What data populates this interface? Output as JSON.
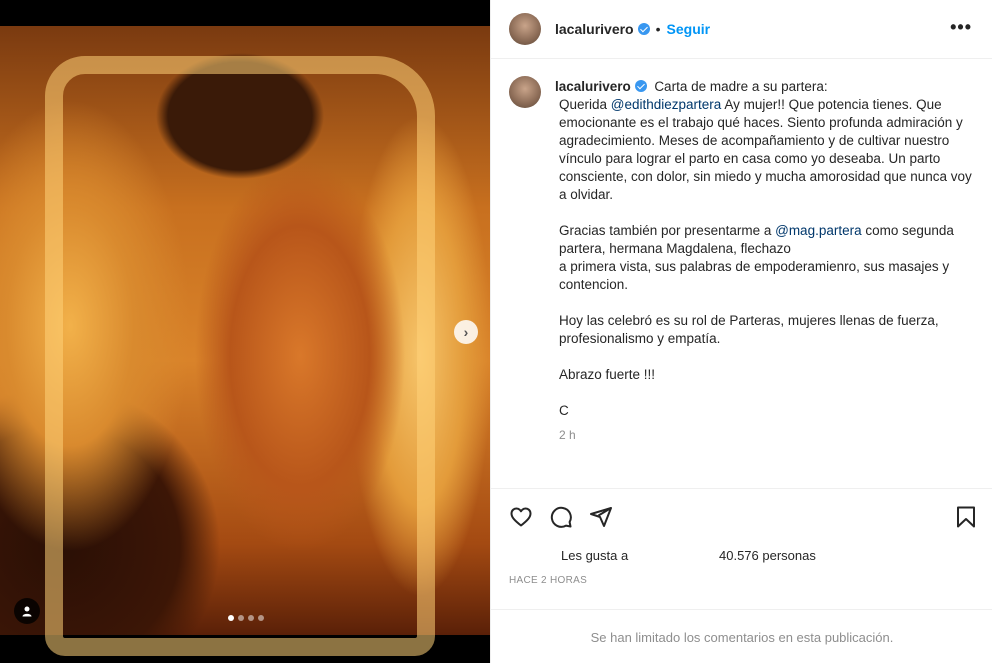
{
  "post": {
    "username": "lacalurivero",
    "follow_label": "Seguir",
    "separator": "•",
    "more_label": "•••",
    "caption_title": "Carta de madre a su partera:",
    "caption": {
      "p1_prefix": "Querida ",
      "p1_mention": "@edithdiezpartera",
      "p1_rest": " Ay mujer!! Que potencia tienes. Que emocionante es el trabajo qué haces. Siento profunda admiración y agradecimiento. Meses de acompañamiento y de cultivar nuestro vínculo para lograr el parto en casa como yo deseaba. Un parto consciente, con dolor, sin miedo y mucha amorosidad que nunca voy a olvidar.",
      "p2_prefix": "Gracias también por presentarme a ",
      "p2_mention": "@mag.partera",
      "p2_rest": " como segunda partera, hermana Magdalena, flechazo",
      "p2_line2": "a primera vista, sus palabras de empoderamienro, sus masajes y contencion.",
      "p3": "Hoy las celebró es su rol de Parteras, mujeres llenas de fuerza, profesionalismo y empatía.",
      "p4": "Abrazo fuerte !!!",
      "p5": "C"
    },
    "time": "2 h",
    "likes_prefix": "Les gusta a",
    "likes_count": "40.576 personas",
    "ago": "HACE 2 HORAS",
    "comments_limited": "Se han limitado los comentarios en esta publicación.",
    "carousel": {
      "total": 4,
      "active": 1
    },
    "icons": [
      "heart-icon",
      "comment-icon",
      "share-icon",
      "bookmark-icon",
      "chevron-right-icon",
      "user-tag-icon",
      "verified-icon"
    ],
    "colors": {
      "accent": "#0095f6",
      "verified": "#3897f0",
      "muted": "#8e8e8e"
    }
  }
}
